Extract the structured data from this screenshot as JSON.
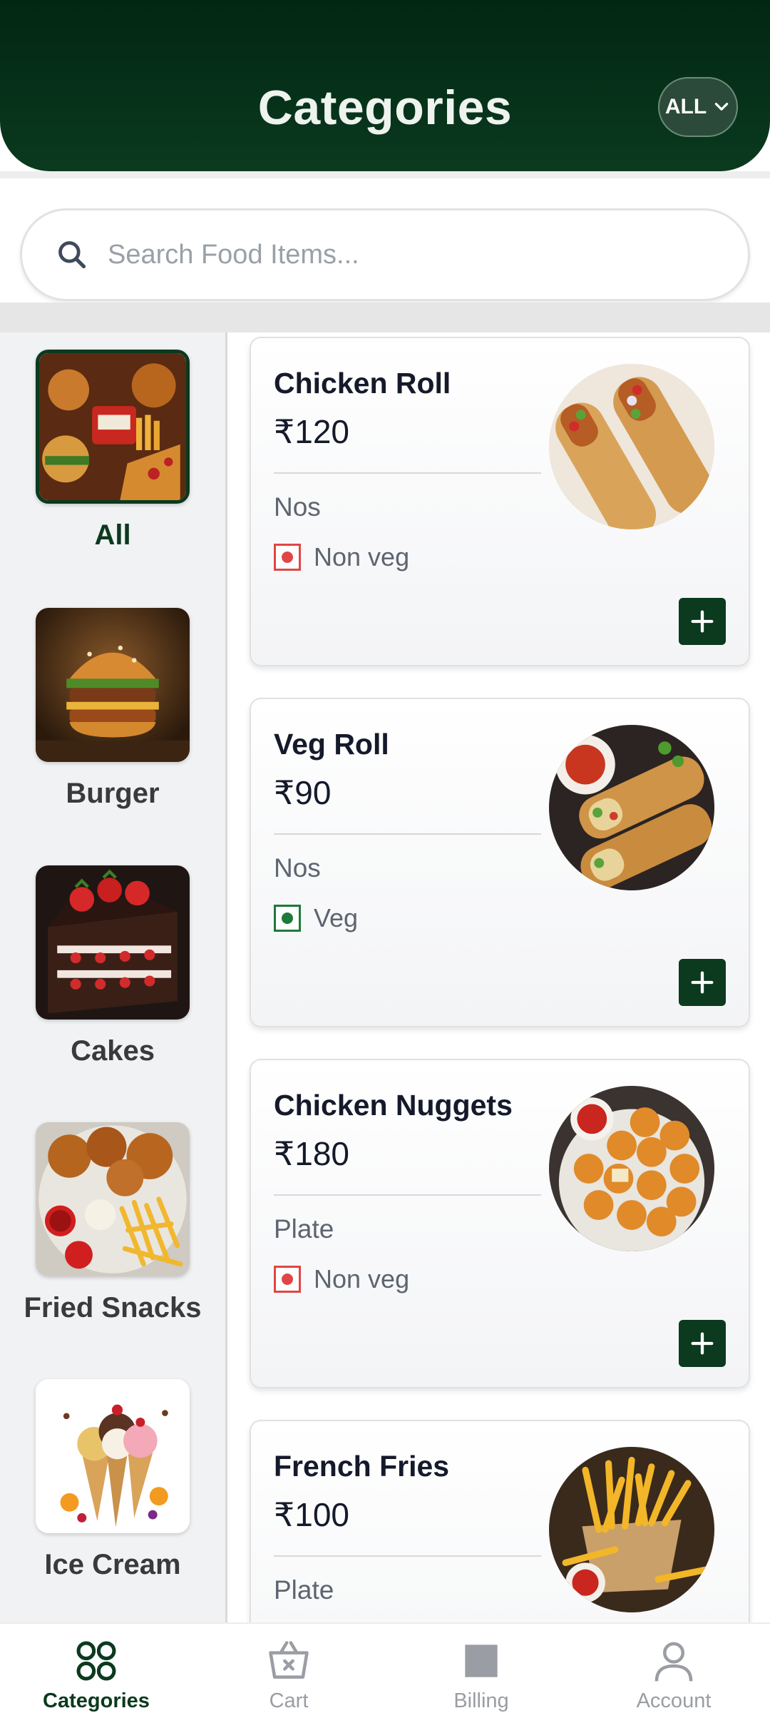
{
  "header": {
    "title": "Categories",
    "filter_label": "ALL"
  },
  "search": {
    "placeholder": "Search Food Items..."
  },
  "categories": [
    {
      "label": "All",
      "active": true
    },
    {
      "label": "Burger",
      "active": false
    },
    {
      "label": "Cakes",
      "active": false
    },
    {
      "label": "Fried Snacks",
      "active": false
    },
    {
      "label": "Ice Cream",
      "active": false
    }
  ],
  "items": [
    {
      "name": "Chicken Roll",
      "price": "₹120",
      "unit": "Nos",
      "type": "Non veg"
    },
    {
      "name": "Veg Roll",
      "price": "₹90",
      "unit": "Nos",
      "type": "Veg"
    },
    {
      "name": "Chicken Nuggets",
      "price": "₹180",
      "unit": "Plate",
      "type": "Non veg"
    },
    {
      "name": "French Fries",
      "price": "₹100",
      "unit": "Plate",
      "type": ""
    }
  ],
  "nav": [
    {
      "label": "Categories",
      "icon": "grid-icon",
      "active": true
    },
    {
      "label": "Cart",
      "icon": "cart-icon",
      "active": false
    },
    {
      "label": "Billing",
      "icon": "billing-icon",
      "active": false
    },
    {
      "label": "Account",
      "icon": "account-icon",
      "active": false
    }
  ],
  "colors": {
    "primary": "#0b3a1e",
    "nonveg": "#e04646",
    "veg": "#1d7a3a"
  }
}
